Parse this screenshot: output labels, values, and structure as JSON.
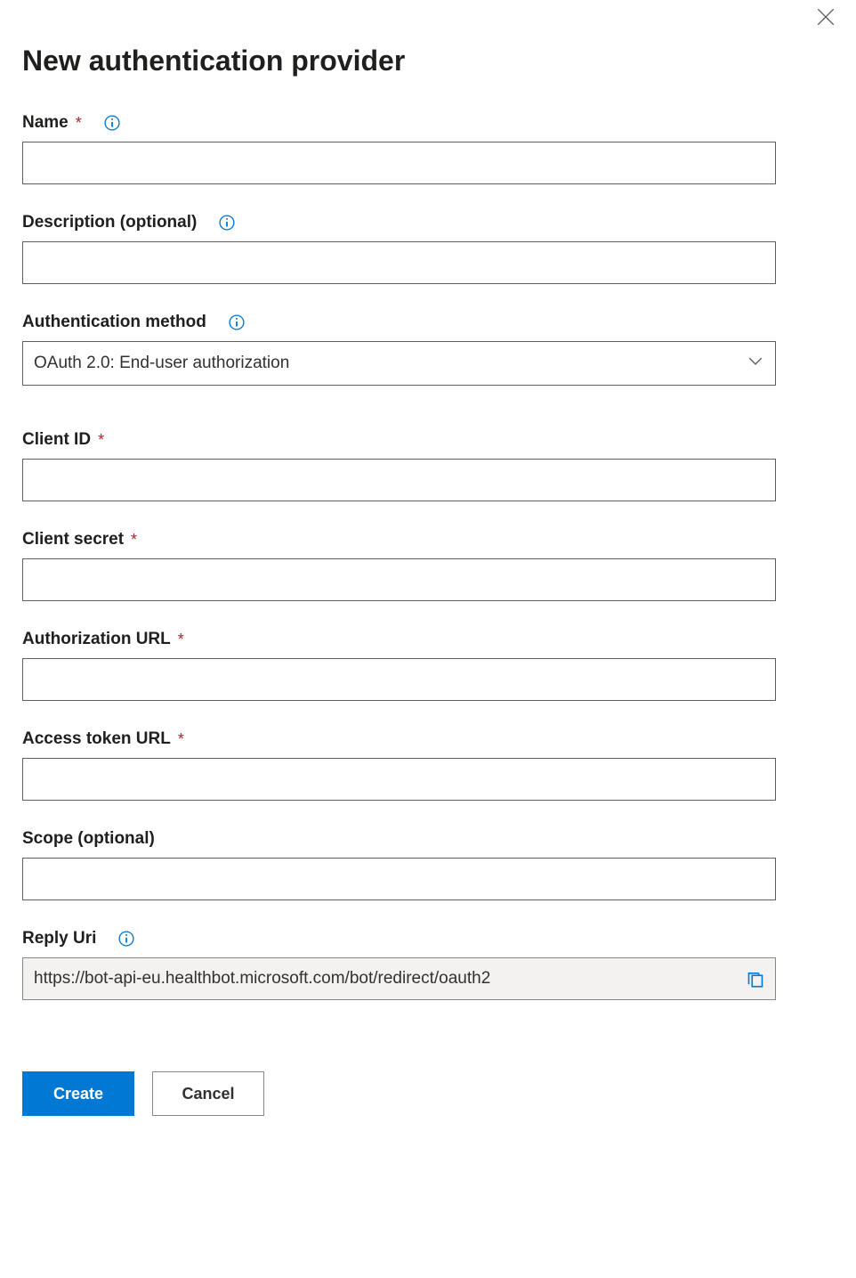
{
  "title": "New authentication provider",
  "fields": {
    "name": {
      "label": "Name",
      "required": true,
      "info": true,
      "value": ""
    },
    "description": {
      "label": "Description (optional)",
      "required": false,
      "info": true,
      "value": ""
    },
    "auth_method": {
      "label": "Authentication method",
      "required": false,
      "info": true,
      "selected": "OAuth 2.0: End-user authorization"
    },
    "client_id": {
      "label": "Client ID",
      "required": true,
      "info": false,
      "value": ""
    },
    "client_secret": {
      "label": "Client secret",
      "required": true,
      "info": false,
      "value": ""
    },
    "auth_url": {
      "label": "Authorization URL",
      "required": true,
      "info": false,
      "value": ""
    },
    "token_url": {
      "label": "Access token URL",
      "required": true,
      "info": false,
      "value": ""
    },
    "scope": {
      "label": "Scope (optional)",
      "required": false,
      "info": false,
      "value": ""
    },
    "reply_uri": {
      "label": "Reply Uri",
      "required": false,
      "info": true,
      "value": "https://bot-api-eu.healthbot.microsoft.com/bot/redirect/oauth2"
    }
  },
  "required_marker": "*",
  "buttons": {
    "create": "Create",
    "cancel": "Cancel"
  }
}
